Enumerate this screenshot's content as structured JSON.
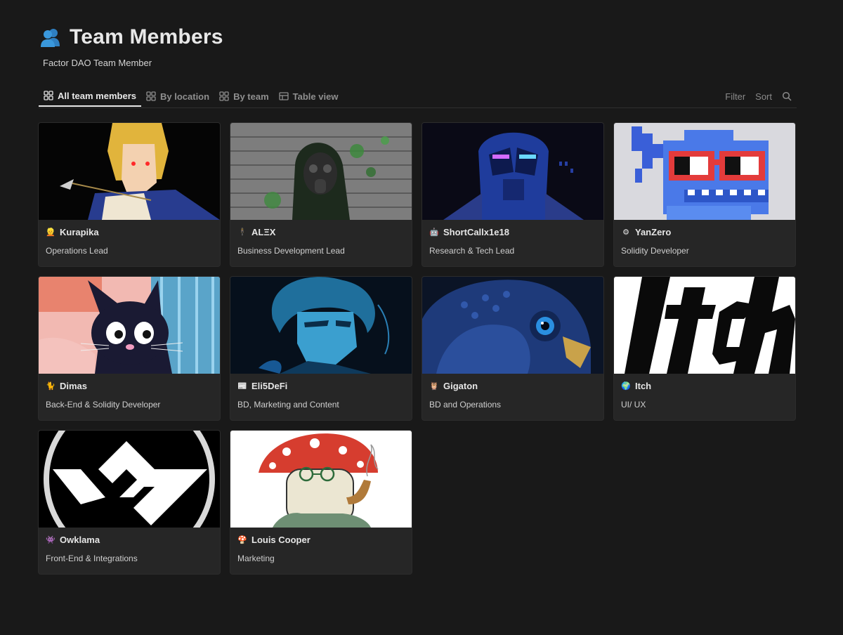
{
  "page": {
    "title": "Team Members",
    "title_icon": "team-members-icon",
    "subtitle": "Factor DAO Team Member"
  },
  "tabs": [
    {
      "label": "All team members",
      "icon": "gallery-icon",
      "active": true
    },
    {
      "label": "By location",
      "icon": "gallery-icon",
      "active": false
    },
    {
      "label": "By team",
      "icon": "gallery-icon",
      "active": false
    },
    {
      "label": "Table view",
      "icon": "table-icon",
      "active": false
    }
  ],
  "toolbar": {
    "filter": "Filter",
    "sort": "Sort",
    "search_icon": "search-icon"
  },
  "members": [
    {
      "emoji": "👱",
      "name": "Kurapika",
      "role": "Operations Lead"
    },
    {
      "emoji": "🕴",
      "name": "ALΞX",
      "role": "Business Development Lead"
    },
    {
      "emoji": "🤖",
      "name": "ShortCallx1e18",
      "role": "Research & Tech Lead"
    },
    {
      "emoji": "⚙",
      "name": "YanZero",
      "role": "Solidity Developer"
    },
    {
      "emoji": "🐈",
      "name": "Dimas",
      "role": "Back-End & Solidity Developer"
    },
    {
      "emoji": "📰",
      "name": "Eli5DeFi",
      "role": "BD, Marketing and Content"
    },
    {
      "emoji": "🦉",
      "name": "Gigaton",
      "role": "BD and Operations"
    },
    {
      "emoji": "🌍",
      "name": "Itch",
      "role": "UI/ UX"
    },
    {
      "emoji": "👾",
      "name": "Owklama",
      "role": "Front-End & Integrations"
    },
    {
      "emoji": "🍄",
      "name": "Louis Cooper",
      "role": "Marketing"
    }
  ],
  "cover_images": [
    "anime-character-cover",
    "gas-mask-cover",
    "robot-cover",
    "pixel-fish-cover",
    "black-cat-cover",
    "anime-portrait-cover",
    "owl-cover",
    "itch-logo-cover",
    "w-logo-cover",
    "mushroom-character-cover"
  ],
  "colors": {
    "background": "#191919",
    "card": "#262626",
    "text": "#e6e6e6",
    "muted": "#8f8f8f"
  }
}
